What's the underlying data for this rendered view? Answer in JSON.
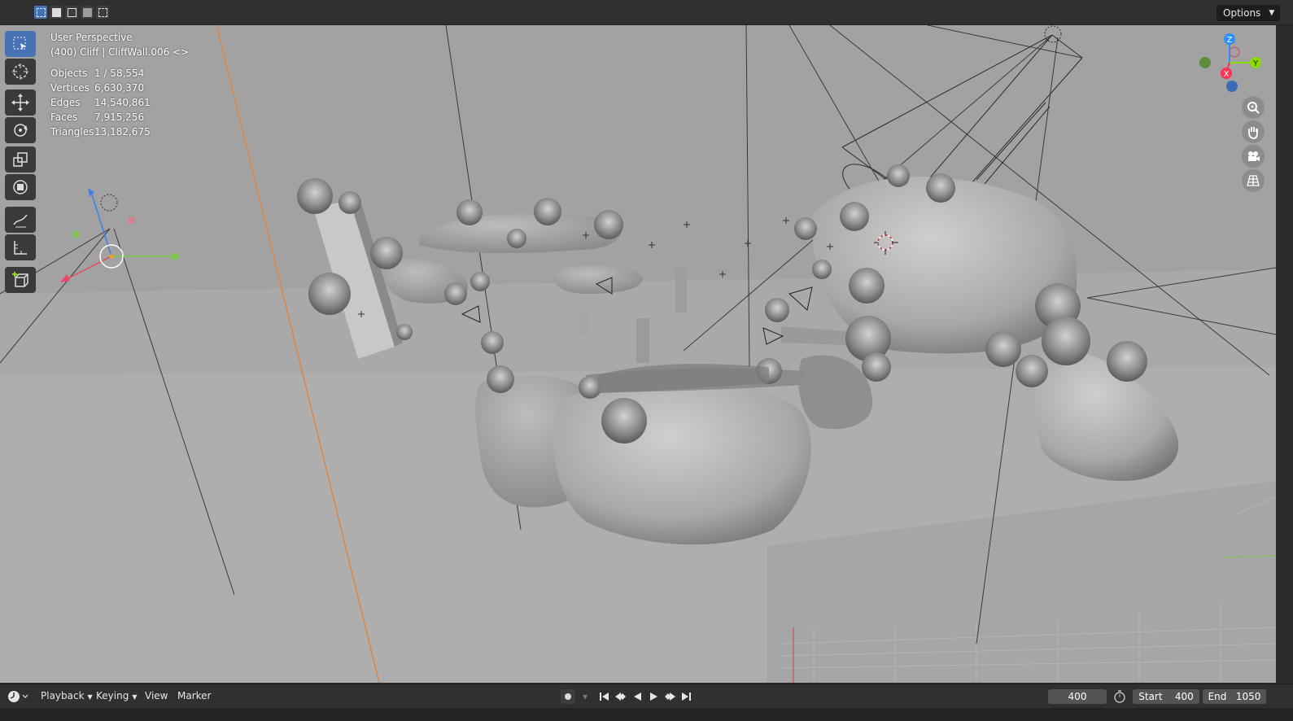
{
  "header": {
    "select_modes": [
      "select-new",
      "select-extend",
      "select-subtract",
      "select-difference",
      "select-intersect"
    ],
    "options_label": "Options"
  },
  "viewport": {
    "view_name": "User Perspective",
    "active_object": "(400) Cliff | CliffWall.006 <>",
    "stats": [
      {
        "label": "Objects",
        "value": "1 / 58,554"
      },
      {
        "label": "Vertices",
        "value": "6,630,370"
      },
      {
        "label": "Edges",
        "value": "14,540,861"
      },
      {
        "label": "Faces",
        "value": "7,915,256"
      },
      {
        "label": "Triangles",
        "value": "13,182,675"
      }
    ],
    "gizmo": {
      "z": "Z",
      "y": "Y",
      "x": "X"
    }
  },
  "tools": [
    "select-box",
    "cursor",
    "move",
    "rotate",
    "scale",
    "transform",
    "annotate",
    "measure",
    "add-cube"
  ],
  "navigation": [
    "zoom",
    "pan",
    "camera-view",
    "perspective-toggle"
  ],
  "timeline": {
    "menus": {
      "playback": "Playback",
      "keying": "Keying",
      "view": "View",
      "marker": "Marker"
    },
    "current_frame": "400",
    "start_label": "Start",
    "start_value": "400",
    "end_label": "End",
    "end_value": "1050"
  },
  "colors": {
    "accent": "#4772b3",
    "axis_x": "#ff3352",
    "axis_y": "#8bdc00",
    "axis_z": "#2890ff",
    "header_bg": "#303030",
    "viewport_bg": "#a2a2a2"
  }
}
